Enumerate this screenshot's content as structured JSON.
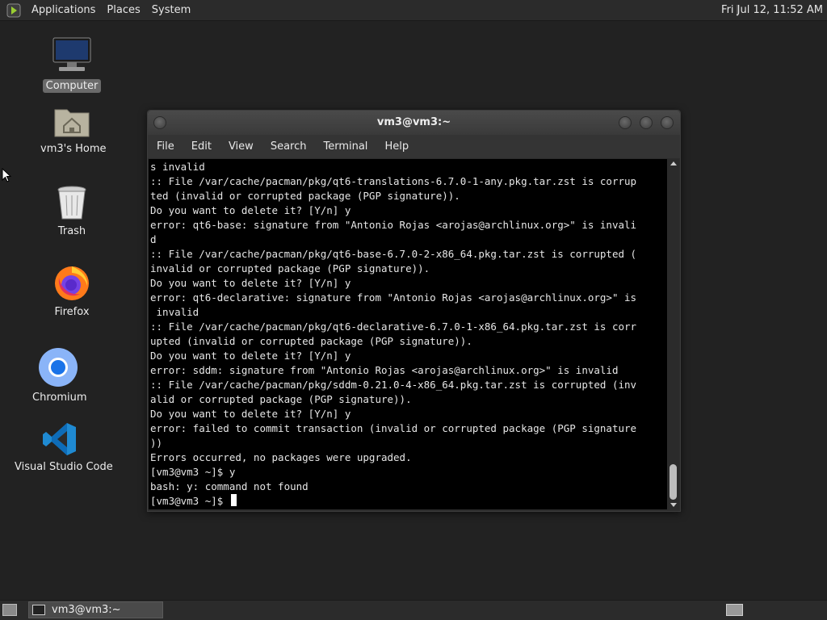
{
  "top_panel": {
    "menus": [
      "Applications",
      "Places",
      "System"
    ],
    "clock": "Fri Jul 12, 11:52 AM"
  },
  "desktop_icons": [
    {
      "name": "Computer",
      "icon": "computer-icon"
    },
    {
      "name": "vm3's Home",
      "icon": "home-folder-icon"
    },
    {
      "name": "Trash",
      "icon": "trash-icon"
    },
    {
      "name": "Firefox",
      "icon": "firefox-icon"
    },
    {
      "name": "Chromium",
      "icon": "chromium-icon"
    },
    {
      "name": "Visual Studio Code",
      "icon": "vscode-icon"
    }
  ],
  "window": {
    "title": "vm3@vm3:~",
    "menu": [
      "File",
      "Edit",
      "View",
      "Search",
      "Terminal",
      "Help"
    ]
  },
  "terminal_lines": [
    "s invalid",
    ":: File /var/cache/pacman/pkg/qt6-translations-6.7.0-1-any.pkg.tar.zst is corrup",
    "ted (invalid or corrupted package (PGP signature)).",
    "Do you want to delete it? [Y/n] y",
    "error: qt6-base: signature from \"Antonio Rojas <arojas@archlinux.org>\" is invali",
    "d",
    ":: File /var/cache/pacman/pkg/qt6-base-6.7.0-2-x86_64.pkg.tar.zst is corrupted (",
    "invalid or corrupted package (PGP signature)).",
    "Do you want to delete it? [Y/n] y",
    "error: qt6-declarative: signature from \"Antonio Rojas <arojas@archlinux.org>\" is",
    " invalid",
    ":: File /var/cache/pacman/pkg/qt6-declarative-6.7.0-1-x86_64.pkg.tar.zst is corr",
    "upted (invalid or corrupted package (PGP signature)).",
    "Do you want to delete it? [Y/n] y",
    "error: sddm: signature from \"Antonio Rojas <arojas@archlinux.org>\" is invalid",
    ":: File /var/cache/pacman/pkg/sddm-0.21.0-4-x86_64.pkg.tar.zst is corrupted (inv",
    "alid or corrupted package (PGP signature)).",
    "Do you want to delete it? [Y/n] y",
    "error: failed to commit transaction (invalid or corrupted package (PGP signature",
    "))",
    "Errors occurred, no packages were upgraded.",
    "[vm3@vm3 ~]$ y",
    "bash: y: command not found",
    "[vm3@vm3 ~]$ "
  ],
  "taskbar": {
    "task_label": "vm3@vm3:~"
  },
  "colors": {
    "desktop_bg": "#222222",
    "panel_bg": "#2b2b2b",
    "terminal_bg": "#000000",
    "terminal_fg": "#e6e6e6"
  }
}
